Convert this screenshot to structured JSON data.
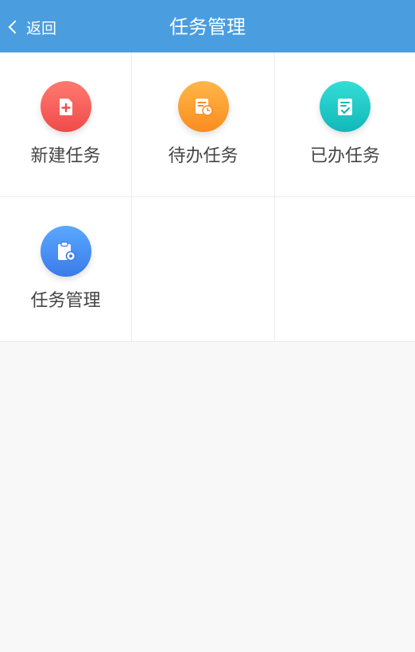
{
  "header": {
    "back_label": "返回",
    "title": "任务管理"
  },
  "tiles": [
    {
      "label": "新建任务",
      "icon": "new-task-icon",
      "color_top": "#ff7a6e",
      "color_bottom": "#ef4b4b"
    },
    {
      "label": "待办任务",
      "icon": "pending-task-icon",
      "color_top": "#ffb74a",
      "color_bottom": "#fb8c1e"
    },
    {
      "label": "已办任务",
      "icon": "done-task-icon",
      "color_top": "#35ddd8",
      "color_bottom": "#11b8b8"
    },
    {
      "label": "任务管理",
      "icon": "task-manage-icon",
      "color_top": "#5aa8ff",
      "color_bottom": "#3a7be8"
    }
  ],
  "colors": {
    "header_bg": "#4a9ddf",
    "page_bg": "#f8f8f8"
  }
}
